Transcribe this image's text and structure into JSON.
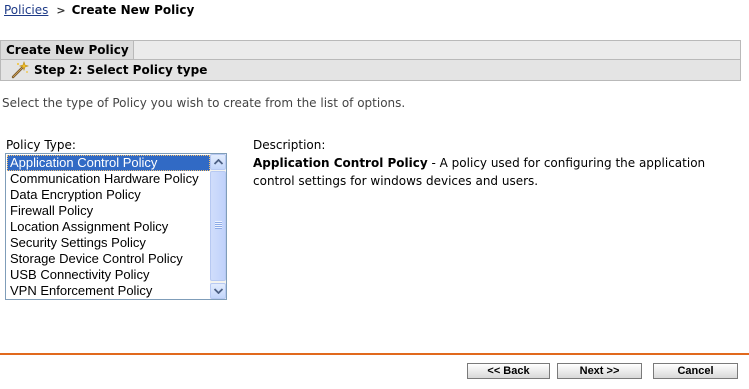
{
  "breadcrumb": {
    "link_label": "Policies",
    "separator": ">",
    "current": "Create New Policy"
  },
  "wizard": {
    "tab_title": "Create New Policy",
    "step_label": "Step 2: Select Policy type",
    "step_icon": "wand-icon"
  },
  "instructions": "Select the type of Policy you wish to create from the list of options.",
  "policy_type": {
    "label": "Policy Type:",
    "selected_index": 0,
    "items": [
      {
        "label": "Application Control Policy"
      },
      {
        "label": "Communication Hardware Policy"
      },
      {
        "label": "Data Encryption Policy"
      },
      {
        "label": "Firewall Policy"
      },
      {
        "label": "Location Assignment Policy"
      },
      {
        "label": "Security Settings Policy"
      },
      {
        "label": "Storage Device Control Policy"
      },
      {
        "label": "USB Connectivity Policy"
      },
      {
        "label": "VPN Enforcement Policy"
      }
    ]
  },
  "description": {
    "label": "Description:",
    "policy_name": "Application Control Policy",
    "text": " - A policy used for configuring the application control settings for windows devices and users."
  },
  "buttons": {
    "back": "<< Back",
    "next": "Next >>",
    "cancel": "Cancel"
  },
  "colors": {
    "selection": "#316ac5",
    "footer_rule": "#e1691d",
    "link": "#1d3a87"
  }
}
